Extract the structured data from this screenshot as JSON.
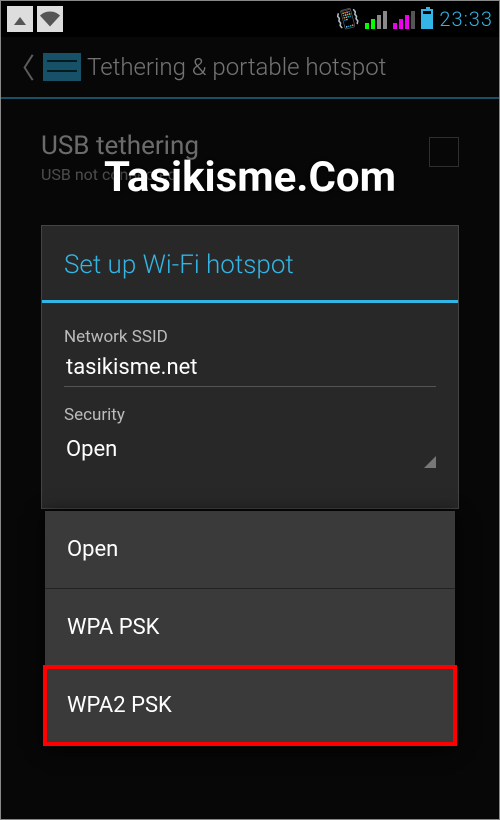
{
  "statusbar": {
    "clock": "23:33"
  },
  "appbar": {
    "title": "Tethering & portable hotspot"
  },
  "bg_row": {
    "title": "USB tethering",
    "subtitle": "USB not connected"
  },
  "watermark": "Tasikisme.Com",
  "dialog": {
    "title": "Set up Wi-Fi hotspot",
    "ssid_label": "Network SSID",
    "ssid_value": "tasikisme.net",
    "security_label": "Security",
    "security_value": "Open"
  },
  "dropdown": {
    "options": [
      "Open",
      "WPA PSK",
      "WPA2 PSK"
    ],
    "highlighted_index": 2
  }
}
